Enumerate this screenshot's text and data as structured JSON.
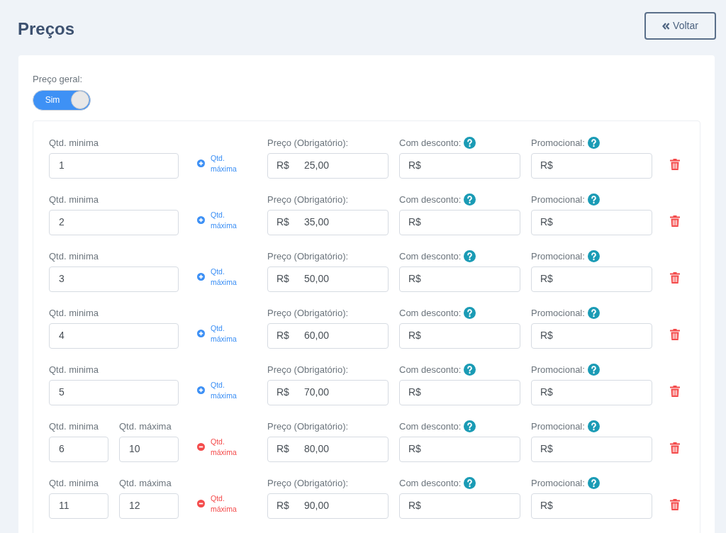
{
  "title": "Preços",
  "back_button": {
    "label": "Voltar"
  },
  "general_price": {
    "label": "Preço geral:",
    "switch_label": "Sim",
    "on": true
  },
  "rows": [
    {
      "min_label": "Qtd. minima",
      "min_value": "1",
      "toggle": {
        "kind": "add",
        "label": "Qtd. máxima"
      },
      "price_label": "Preço (Obrigatório):",
      "price_prefix": "R$",
      "price_value": "25,00",
      "discount_label": "Com desconto:",
      "discount_prefix": "R$",
      "promo_label": "Promocional:",
      "promo_prefix": "R$"
    },
    {
      "min_label": "Qtd. minima",
      "min_value": "2",
      "toggle": {
        "kind": "add",
        "label": "Qtd. máxima"
      },
      "price_label": "Preço (Obrigatório):",
      "price_prefix": "R$",
      "price_value": "35,00",
      "discount_label": "Com desconto:",
      "discount_prefix": "R$",
      "promo_label": "Promocional:",
      "promo_prefix": "R$"
    },
    {
      "min_label": "Qtd. minima",
      "min_value": "3",
      "toggle": {
        "kind": "add",
        "label": "Qtd. máxima"
      },
      "price_label": "Preço (Obrigatório):",
      "price_prefix": "R$",
      "price_value": "50,00",
      "discount_label": "Com desconto:",
      "discount_prefix": "R$",
      "promo_label": "Promocional:",
      "promo_prefix": "R$"
    },
    {
      "min_label": "Qtd. minima",
      "min_value": "4",
      "toggle": {
        "kind": "add",
        "label": "Qtd. máxima"
      },
      "price_label": "Preço (Obrigatório):",
      "price_prefix": "R$",
      "price_value": "60,00",
      "discount_label": "Com desconto:",
      "discount_prefix": "R$",
      "promo_label": "Promocional:",
      "promo_prefix": "R$"
    },
    {
      "min_label": "Qtd. minima",
      "min_value": "5",
      "toggle": {
        "kind": "add",
        "label": "Qtd. máxima"
      },
      "price_label": "Preço (Obrigatório):",
      "price_prefix": "R$",
      "price_value": "70,00",
      "discount_label": "Com desconto:",
      "discount_prefix": "R$",
      "promo_label": "Promocional:",
      "promo_prefix": "R$"
    },
    {
      "min_label": "Qtd. minima",
      "min_value": "6",
      "max_label": "Qtd. máxima",
      "max_value": "10",
      "toggle": {
        "kind": "remove",
        "label": "Qtd. máxima"
      },
      "price_label": "Preço (Obrigatório):",
      "price_prefix": "R$",
      "price_value": "80,00",
      "discount_label": "Com desconto:",
      "discount_prefix": "R$",
      "promo_label": "Promocional:",
      "promo_prefix": "R$"
    },
    {
      "min_label": "Qtd. minima",
      "min_value": "11",
      "max_label": "Qtd. máxima",
      "max_value": "12",
      "toggle": {
        "kind": "remove",
        "label": "Qtd. máxima"
      },
      "price_label": "Preço (Obrigatório):",
      "price_prefix": "R$",
      "price_value": "90,00",
      "discount_label": "Com desconto:",
      "discount_prefix": "R$",
      "promo_label": "Promocional:",
      "promo_prefix": "R$"
    }
  ]
}
